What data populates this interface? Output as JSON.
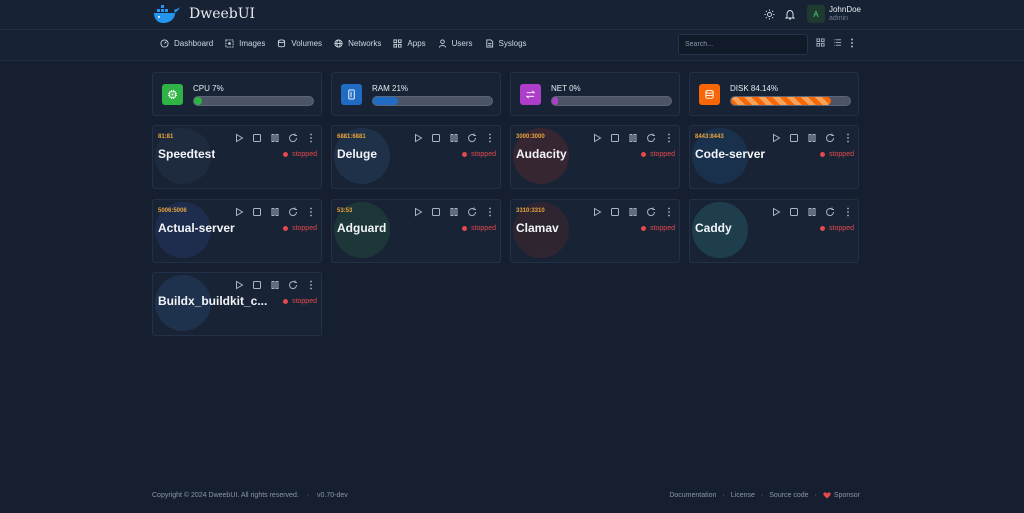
{
  "app": {
    "name": "DweebUI"
  },
  "user": {
    "initial": "A",
    "name": "JohnDoe",
    "role": "admin"
  },
  "nav": {
    "items": [
      {
        "label": "Dashboard",
        "icon": "dashboard-icon"
      },
      {
        "label": "Images",
        "icon": "images-icon"
      },
      {
        "label": "Volumes",
        "icon": "volumes-icon"
      },
      {
        "label": "Networks",
        "icon": "networks-icon"
      },
      {
        "label": "Apps",
        "icon": "apps-icon"
      },
      {
        "label": "Users",
        "icon": "users-icon"
      },
      {
        "label": "Syslogs",
        "icon": "syslogs-icon"
      }
    ],
    "search_placeholder": "Search..."
  },
  "stats": [
    {
      "label": "CPU 7%",
      "percent": 7,
      "color": "#2fb344",
      "icon": "cpu-icon"
    },
    {
      "label": "RAM 21%",
      "percent": 21,
      "color": "#206bc4",
      "icon": "ram-icon"
    },
    {
      "label": "NET 0%",
      "percent": 0,
      "color": "#ae3ec9",
      "icon": "network-transfer-icon"
    },
    {
      "label": "DISK 84.14%",
      "percent": 84.14,
      "color": "#f76707",
      "icon": "disk-icon"
    }
  ],
  "containers": [
    {
      "name": "Speedtest",
      "port": "81:81",
      "status": "stopped"
    },
    {
      "name": "Deluge",
      "port": "6881:6881",
      "status": "stopped"
    },
    {
      "name": "Audacity",
      "port": "3000:3000",
      "status": "stopped"
    },
    {
      "name": "Code-server",
      "port": "8443:8443",
      "status": "stopped"
    },
    {
      "name": "Actual-server",
      "port": "5006:5006",
      "status": "stopped"
    },
    {
      "name": "Adguard",
      "port": "53:53",
      "status": "stopped"
    },
    {
      "name": "Clamav",
      "port": "3310:3310",
      "status": "stopped"
    },
    {
      "name": "Caddy",
      "port": "",
      "status": "stopped"
    },
    {
      "name": "Buildx_buildkit_c...",
      "port": "",
      "status": "stopped"
    }
  ],
  "footer": {
    "copyright": "Copyright © 2024 DweebUI. All rights reserved.",
    "version": "v0.70-dev",
    "links": [
      "Documentation",
      "License",
      "Source code",
      "Sponsor"
    ]
  },
  "colors": {
    "accent": "#206bc4",
    "stopped": "#e5484d",
    "port": "#e8a33b"
  }
}
